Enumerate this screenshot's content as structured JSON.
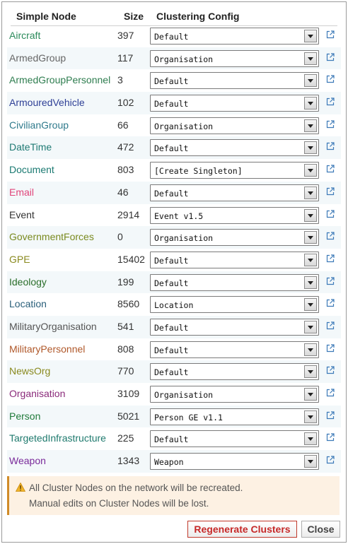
{
  "headers": {
    "node": "Simple Node",
    "size": "Size",
    "config": "Clustering Config"
  },
  "rows": [
    {
      "name": "Aircraft",
      "size": "397",
      "config": "Default",
      "color": "#2a8a5a"
    },
    {
      "name": "ArmedGroup",
      "size": "117",
      "config": "Organisation",
      "color": "#666666"
    },
    {
      "name": "ArmedGroupPersonnel",
      "size": "3",
      "config": "Default",
      "color": "#2e7d4f"
    },
    {
      "name": "ArmouredVehicle",
      "size": "102",
      "config": "Default",
      "color": "#2e3f96"
    },
    {
      "name": "CivilianGroup",
      "size": "66",
      "config": "Organisation",
      "color": "#2f7a8c"
    },
    {
      "name": "DateTime",
      "size": "472",
      "config": "Default",
      "color": "#1f7a74"
    },
    {
      "name": "Document",
      "size": "803",
      "config": "[Create Singleton]",
      "color": "#1b7a72"
    },
    {
      "name": "Email",
      "size": "46",
      "config": "Default",
      "color": "#e0457a"
    },
    {
      "name": "Event",
      "size": "2914",
      "config": "Event v1.5",
      "color": "#333333"
    },
    {
      "name": "GovernmentForces",
      "size": "0",
      "config": "Organisation",
      "color": "#7a8a1f"
    },
    {
      "name": "GPE",
      "size": "15402",
      "config": "Default",
      "color": "#8a8a1f"
    },
    {
      "name": "Ideology",
      "size": "199",
      "config": "Default",
      "color": "#2a6e2a"
    },
    {
      "name": "Location",
      "size": "8560",
      "config": "Location",
      "color": "#2a5f7a"
    },
    {
      "name": "MilitaryOrganisation",
      "size": "541",
      "config": "Default",
      "color": "#555555"
    },
    {
      "name": "MilitaryPersonnel",
      "size": "808",
      "config": "Default",
      "color": "#b0582a"
    },
    {
      "name": "NewsOrg",
      "size": "770",
      "config": "Default",
      "color": "#8a8a1f"
    },
    {
      "name": "Organisation",
      "size": "3109",
      "config": "Organisation",
      "color": "#8a2a7a"
    },
    {
      "name": "Person",
      "size": "5021",
      "config": "Person GE v1.1",
      "color": "#1f7a3a"
    },
    {
      "name": "TargetedInfrastructure",
      "size": "225",
      "config": "Default",
      "color": "#1f7a6e"
    },
    {
      "name": "Weapon",
      "size": "1343",
      "config": "Weapon",
      "color": "#7a2a9a"
    }
  ],
  "warning": {
    "line1": "All Cluster Nodes on the network will be recreated.",
    "line2": "Manual edits on Cluster Nodes will be lost."
  },
  "buttons": {
    "regenerate": "Regenerate Clusters",
    "close": "Close"
  }
}
